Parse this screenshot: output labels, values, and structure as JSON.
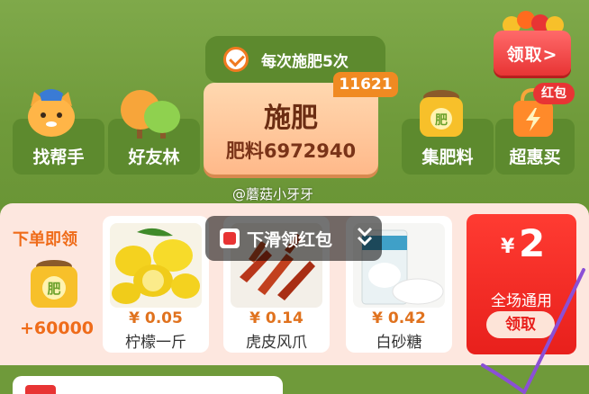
{
  "gift": {
    "label": "领取>"
  },
  "task": {
    "text": "每次施肥5次"
  },
  "fertilize": {
    "label": "施肥",
    "amount": "肥料6972940",
    "badge": "11621"
  },
  "side_buttons": {
    "helper": "找帮手",
    "forest": "好友林",
    "collect": "集肥料",
    "deal": "超惠买",
    "deal_tag": "红包",
    "bag_char": "肥"
  },
  "watermark": "@蘑菇小牙牙",
  "order": {
    "title": "下单即领",
    "reward": "+60000",
    "bag_char": "肥"
  },
  "overlay": {
    "text": "下滑领红包"
  },
  "products": [
    {
      "price": "¥ 0.05",
      "name": "柠檬一斤"
    },
    {
      "price": "¥ 0.14",
      "name": "虎皮风爪"
    },
    {
      "price": "¥ 0.42",
      "name": "白砂糖"
    }
  ],
  "coupon": {
    "currency": "¥",
    "amount": "2",
    "note": "全场通用",
    "claim": "领取"
  },
  "colors": {
    "accent": "#ef6c1a",
    "red": "#e8201c",
    "green": "#6f9a3a"
  }
}
